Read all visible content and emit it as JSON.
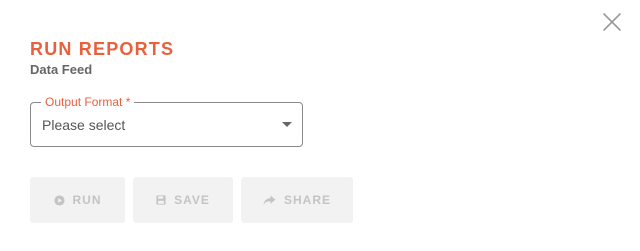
{
  "dialog": {
    "title": "RUN REPORTS",
    "subtitle": "Data Feed",
    "close_icon": "close-icon"
  },
  "output_format": {
    "label": "Output Format *",
    "value": "Please select",
    "caret_icon": "caret-down-icon"
  },
  "actions": {
    "run_label": "RUN",
    "run_icon": "play-circle-icon",
    "save_label": "SAVE",
    "save_icon": "floppy-disk-icon",
    "share_label": "SHARE",
    "share_icon": "share-arrow-icon"
  },
  "colors": {
    "accent": "#e8603c",
    "subtitle": "#666666",
    "disabled_text": "#c4c4c4",
    "disabled_bg": "#f2f2f2"
  }
}
